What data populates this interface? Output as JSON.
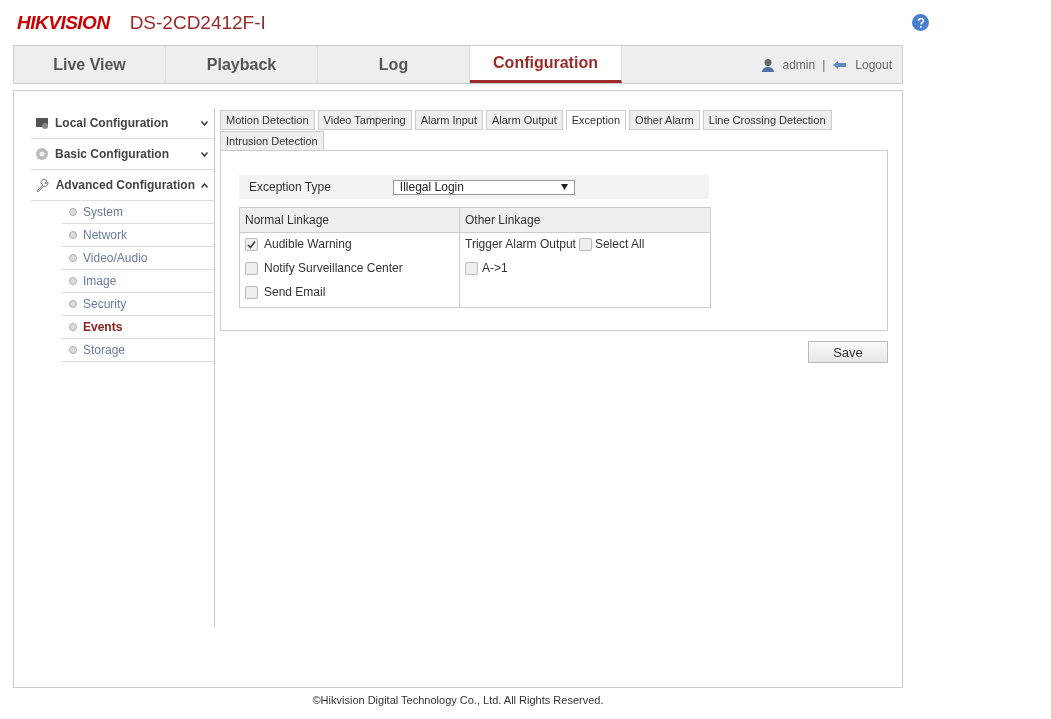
{
  "header": {
    "brand": "HIKVISION",
    "model": "DS-2CD2412F-I"
  },
  "nav": {
    "tabs": [
      {
        "label": "Live View",
        "selected": false
      },
      {
        "label": "Playback",
        "selected": false
      },
      {
        "label": "Log",
        "selected": false
      },
      {
        "label": "Configuration",
        "selected": true
      }
    ],
    "user": "admin",
    "separator": "|",
    "logout": "Logout"
  },
  "sidebar": {
    "groups": [
      {
        "label": "Local Configuration",
        "expanded": false
      },
      {
        "label": "Basic Configuration",
        "expanded": false
      },
      {
        "label": "Advanced Configuration",
        "expanded": true,
        "children": [
          {
            "label": "System",
            "selected": false
          },
          {
            "label": "Network",
            "selected": false
          },
          {
            "label": "Video/Audio",
            "selected": false
          },
          {
            "label": "Image",
            "selected": false
          },
          {
            "label": "Security",
            "selected": false
          },
          {
            "label": "Events",
            "selected": true
          },
          {
            "label": "Storage",
            "selected": false
          }
        ]
      }
    ]
  },
  "tabs": [
    {
      "label": "Motion Detection",
      "selected": false
    },
    {
      "label": "Video Tampering",
      "selected": false
    },
    {
      "label": "Alarm Input",
      "selected": false
    },
    {
      "label": "Alarm Output",
      "selected": false
    },
    {
      "label": "Exception",
      "selected": true
    },
    {
      "label": "Other Alarm",
      "selected": false
    },
    {
      "label": "Line Crossing Detection",
      "selected": false
    },
    {
      "label": "Intrusion Detection",
      "selected": false
    }
  ],
  "exception_type": {
    "label": "Exception Type",
    "value": "Illegal Login"
  },
  "linkage": {
    "normal_heading": "Normal Linkage",
    "other_heading": "Other Linkage",
    "normal": [
      {
        "label": "Audible Warning",
        "checked": true
      },
      {
        "label": "Notify Surveillance Center",
        "checked": false
      },
      {
        "label": "Send Email",
        "checked": false
      }
    ],
    "trigger_label": "Trigger Alarm Output",
    "select_all": {
      "label": "Select All",
      "checked": false
    },
    "outputs": [
      {
        "label": "A->1",
        "checked": false
      }
    ]
  },
  "save": "Save",
  "footer": "©Hikvision Digital Technology Co., Ltd. All Rights Reserved."
}
